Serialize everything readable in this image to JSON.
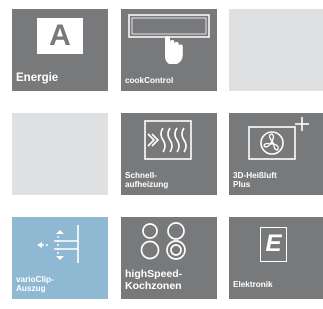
{
  "tiles": [
    {
      "label": "Energie",
      "icon": "energy-class-a-icon",
      "glyph": "A"
    },
    {
      "label": "cookControl",
      "icon": "touch-control-icon"
    },
    {
      "label": ""
    },
    {
      "label": ""
    },
    {
      "label": "Schnell-\naufheizung",
      "icon": "rapid-heating-icon"
    },
    {
      "label": "3D-Heißluft\nPlus",
      "icon": "fan-plus-icon"
    },
    {
      "label": "varioClip-\nAuszug",
      "icon": "telescopic-rail-icon"
    },
    {
      "label": "highSpeed-\nKochzonen",
      "icon": "cooking-zones-icon"
    },
    {
      "label": "Elektronik",
      "icon": "electronic-display-icon",
      "glyph": "E"
    }
  ],
  "colors": {
    "tile_dark": "#78797b",
    "tile_empty": "#dfe0e2",
    "tile_blue": "#8fb8d3",
    "text": "#ffffff"
  }
}
